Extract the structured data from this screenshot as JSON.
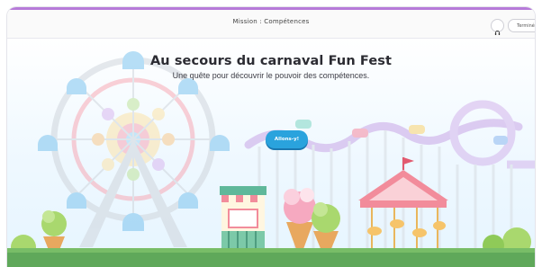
{
  "header": {
    "title": "Mission : Compétences",
    "headset_icon": "headphones-icon",
    "done_label": "Terminé"
  },
  "hero": {
    "title": "Au secours du carnaval Fun Fest",
    "subtitle": "Une quête pour découvrir le pouvoir des compétences.",
    "cta_label": "Allons-y!"
  },
  "colors": {
    "accent_bar": "#b77ad9",
    "cta": "#2aa3dd",
    "grass": "#5fa85a",
    "sky": "#eef8ff"
  },
  "illustration": {
    "subject": "carnival-scene",
    "elements": [
      "ferris-wheel-icon",
      "roller-coaster-icon",
      "carousel-icon",
      "ticket-booth-icon",
      "ice-cream-icon"
    ]
  }
}
